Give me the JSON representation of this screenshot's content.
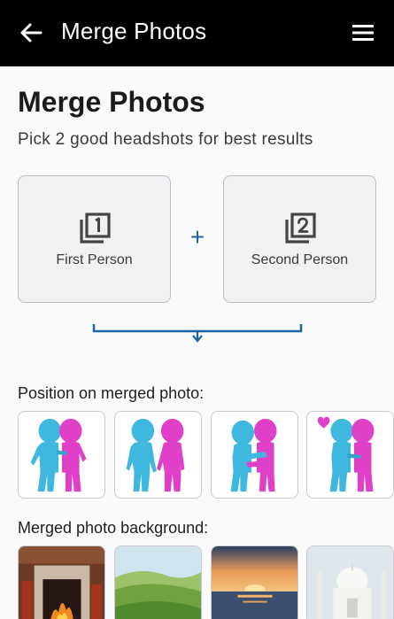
{
  "appbar": {
    "title": "Merge Photos",
    "back_icon": "arrow-left-icon",
    "menu_icon": "hamburger-menu-icon"
  },
  "header": {
    "title": "Merge Photos",
    "subtitle": "Pick 2 good headshots for best results"
  },
  "cards": [
    {
      "label": "First Person",
      "icon": "filter-1-icon"
    },
    {
      "label": "Second Person",
      "icon": "filter-2-icon"
    }
  ],
  "plus_symbol": "+",
  "positions": {
    "label": "Position on merged photo:",
    "options": [
      "side-by-side-hugging",
      "holding-hands",
      "embracing",
      "heart-couple"
    ]
  },
  "backgrounds": {
    "label": "Merged photo background:",
    "options": [
      "fireplace",
      "green-hills",
      "sunset-sea",
      "taj-mahal"
    ]
  },
  "colors": {
    "accent": "#1c64a8",
    "appbar": "#000000",
    "figure_blue": "#3fb8e0",
    "figure_pink": "#e040c8"
  }
}
